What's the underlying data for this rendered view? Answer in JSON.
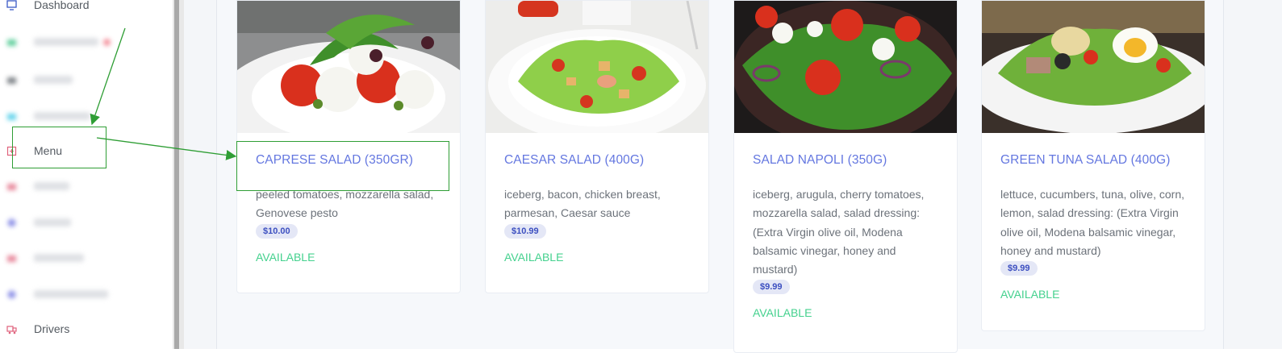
{
  "sidebar": {
    "items": [
      {
        "label": "Dashboard",
        "icon": "monitor-icon",
        "color": "#3a59c7",
        "blurred": false
      },
      {
        "label": "",
        "icon": "cart-icon",
        "color": "#2fc07e",
        "blurred": true
      },
      {
        "label": "",
        "icon": "box-icon",
        "color": "#555b62",
        "blurred": true
      },
      {
        "label": "",
        "icon": "store-icon",
        "color": "#35c6e6",
        "blurred": true
      },
      {
        "label": "Menu",
        "icon": "menu-book-icon",
        "color": "#e0627c",
        "blurred": false
      },
      {
        "label": "",
        "icon": "table-icon",
        "color": "#e0627c",
        "blurred": true
      },
      {
        "label": "",
        "icon": "user-icon",
        "color": "#6a6fe0",
        "blurred": true
      },
      {
        "label": "",
        "icon": "coupon-icon",
        "color": "#e0627c",
        "blurred": true
      },
      {
        "label": "",
        "icon": "location-icon",
        "color": "#6a6fe0",
        "blurred": true
      },
      {
        "label": "Drivers",
        "icon": "truck-icon",
        "color": "#e0627c",
        "blurred": false
      }
    ]
  },
  "menu_items": [
    {
      "title": "CAPRESE SALAD (350GR)",
      "description": "peeled tomatoes, mozzarella salad, Genovese pesto",
      "price": "$10.00",
      "status": "AVAILABLE"
    },
    {
      "title": "CAESAR SALAD (400G)",
      "description": "iceberg, bacon, chicken breast, parmesan, Caesar sauce",
      "price": "$10.99",
      "status": "AVAILABLE"
    },
    {
      "title": "SALAD NAPOLI (350G)",
      "description": "iceberg, arugula, cherry tomatoes, mozzarella salad, salad dressing: (Extra Virgin olive oil, Modena balsamic vinegar, honey and mustard)",
      "price": "$9.99",
      "status": "AVAILABLE"
    },
    {
      "title": "GREEN TUNA SALAD (400G)",
      "description": "lettuce, cucumbers, tuna, olive, corn, lemon, salad dressing: (Extra Virgin olive oil, Modena balsamic vinegar, honey and mustard)",
      "price": "$9.99",
      "status": "AVAILABLE"
    }
  ],
  "colors": {
    "accent": "#6477e0",
    "available": "#44d18e",
    "annotation": "#2f9e35"
  }
}
